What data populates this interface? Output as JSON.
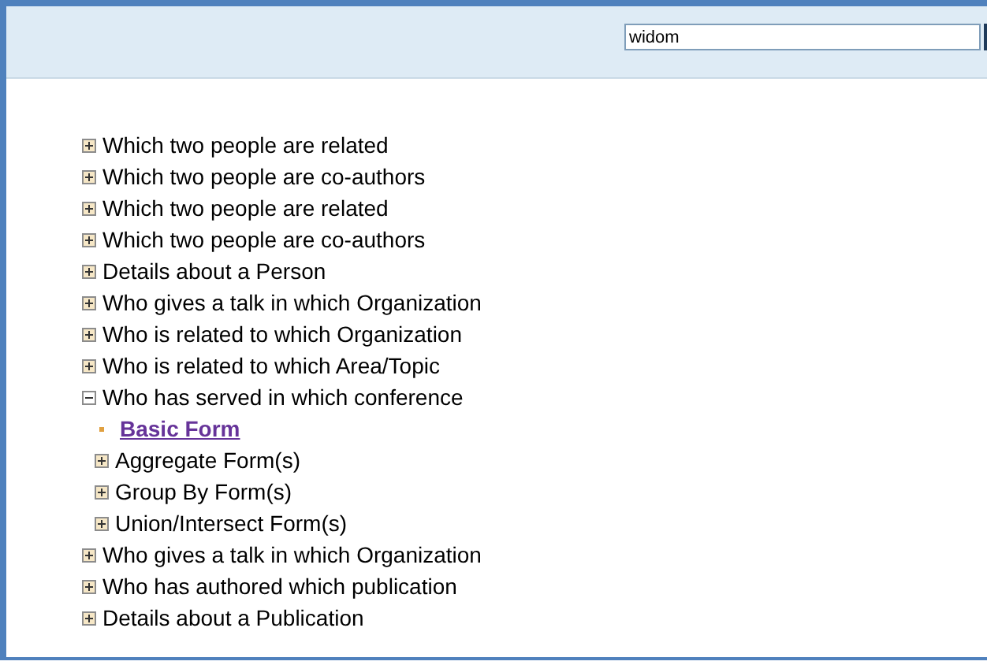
{
  "search": {
    "value": "widom"
  },
  "tree": [
    {
      "label": "Which two people are related",
      "kind": "folder",
      "expanded": false
    },
    {
      "label": "Which two people are co-authors",
      "kind": "folder",
      "expanded": false
    },
    {
      "label": "Which two people are related",
      "kind": "folder",
      "expanded": false
    },
    {
      "label": "Which two people are co-authors",
      "kind": "folder",
      "expanded": false
    },
    {
      "label": "Details about a Person",
      "kind": "folder",
      "expanded": false
    },
    {
      "label": "Who gives a talk in which Organization",
      "kind": "folder",
      "expanded": false
    },
    {
      "label": "Who is related to which Organization",
      "kind": "folder",
      "expanded": false
    },
    {
      "label": "Who is related to which Area/Topic",
      "kind": "folder",
      "expanded": false
    },
    {
      "label": "Who has served in which conference",
      "kind": "folder",
      "expanded": true,
      "children": [
        {
          "label": "Basic Form",
          "kind": "link"
        },
        {
          "label": "Aggregate Form(s)",
          "kind": "folder",
          "expanded": false
        },
        {
          "label": "Group By Form(s)",
          "kind": "folder",
          "expanded": false
        },
        {
          "label": "Union/Intersect Form(s)",
          "kind": "folder",
          "expanded": false
        }
      ]
    },
    {
      "label": "Who gives a talk in which Organization",
      "kind": "folder",
      "expanded": false
    },
    {
      "label": "Who has authored which publication",
      "kind": "folder",
      "expanded": false
    },
    {
      "label": "Details about a Publication",
      "kind": "folder",
      "expanded": false
    }
  ]
}
